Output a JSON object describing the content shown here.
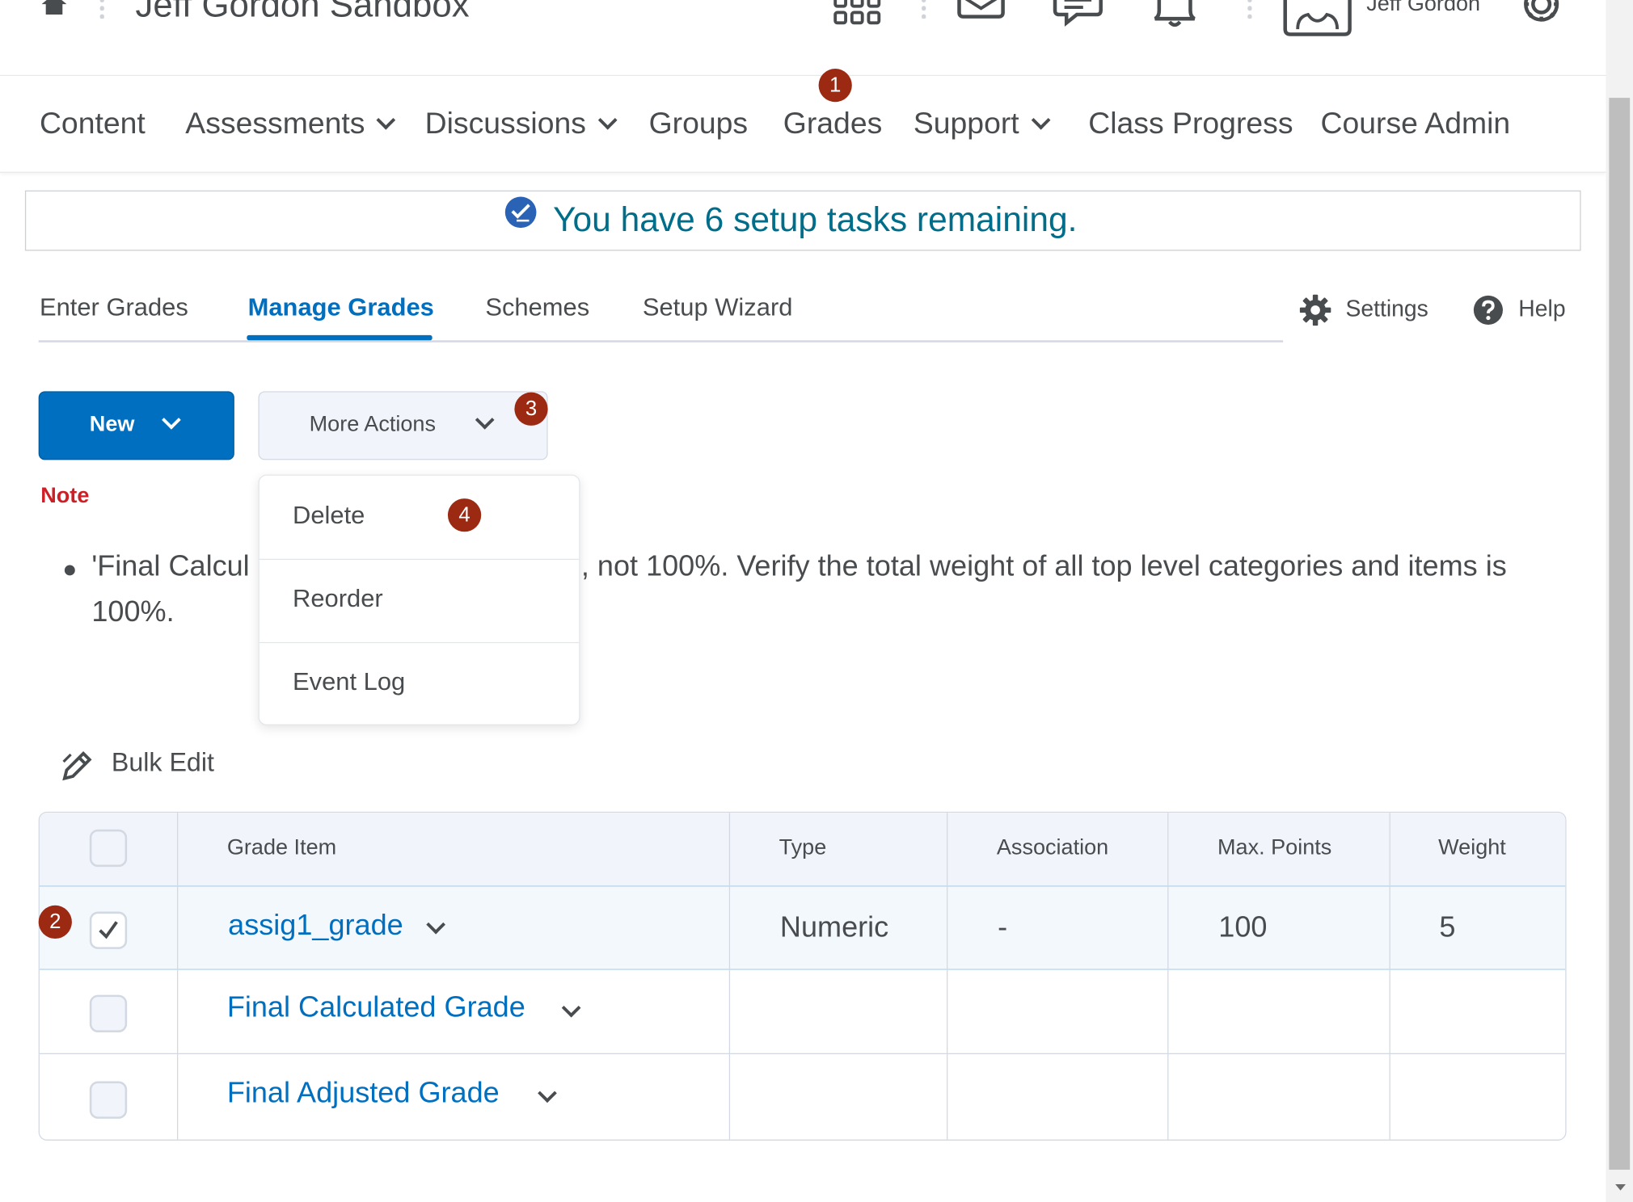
{
  "header": {
    "course_title": "Jeff Gordon Sandbox",
    "user_name": "Jeff Gordon"
  },
  "nav": {
    "content": "Content",
    "assessments": "Assessments",
    "discussions": "Discussions",
    "groups": "Groups",
    "grades": "Grades",
    "support": "Support",
    "class_progress": "Class Progress",
    "course_admin": "Course Admin"
  },
  "setup": {
    "message": "You have 6 setup tasks remaining."
  },
  "tabs": {
    "enter_grades": "Enter Grades",
    "manage_grades": "Manage Grades",
    "schemes": "Schemes",
    "setup_wizard": "Setup Wizard",
    "settings": "Settings",
    "help": "Help"
  },
  "toolbar": {
    "new": "New",
    "more_actions": "More Actions"
  },
  "menu": {
    "delete": "Delete",
    "reorder": "Reorder",
    "event_log": "Event Log"
  },
  "note": {
    "title": "Note",
    "line1_left": "'Final Calcul",
    "line1_right": ", not 100%. Verify the total weight of all top level categories and items is",
    "line2": "100%."
  },
  "bulk_edit": "Bulk Edit",
  "table": {
    "headers": {
      "grade_item": "Grade Item",
      "type": "Type",
      "association": "Association",
      "max_points": "Max. Points",
      "weight": "Weight"
    },
    "rows": [
      {
        "name": "assig1_grade",
        "type": "Numeric",
        "association": "-",
        "max_points": "100",
        "weight": "5",
        "checked": true
      },
      {
        "name": "Final Calculated Grade",
        "type": "",
        "association": "",
        "max_points": "",
        "weight": "",
        "checked": false
      },
      {
        "name": "Final Adjusted Grade",
        "type": "",
        "association": "",
        "max_points": "",
        "weight": "",
        "checked": false
      }
    ]
  },
  "badges": {
    "b1": "1",
    "b2": "2",
    "b3": "3",
    "b4": "4"
  },
  "colors": {
    "primary": "#006fbf",
    "badge": "#9c2a13",
    "note_red": "#cd2026",
    "setup_teal": "#006e8a"
  }
}
